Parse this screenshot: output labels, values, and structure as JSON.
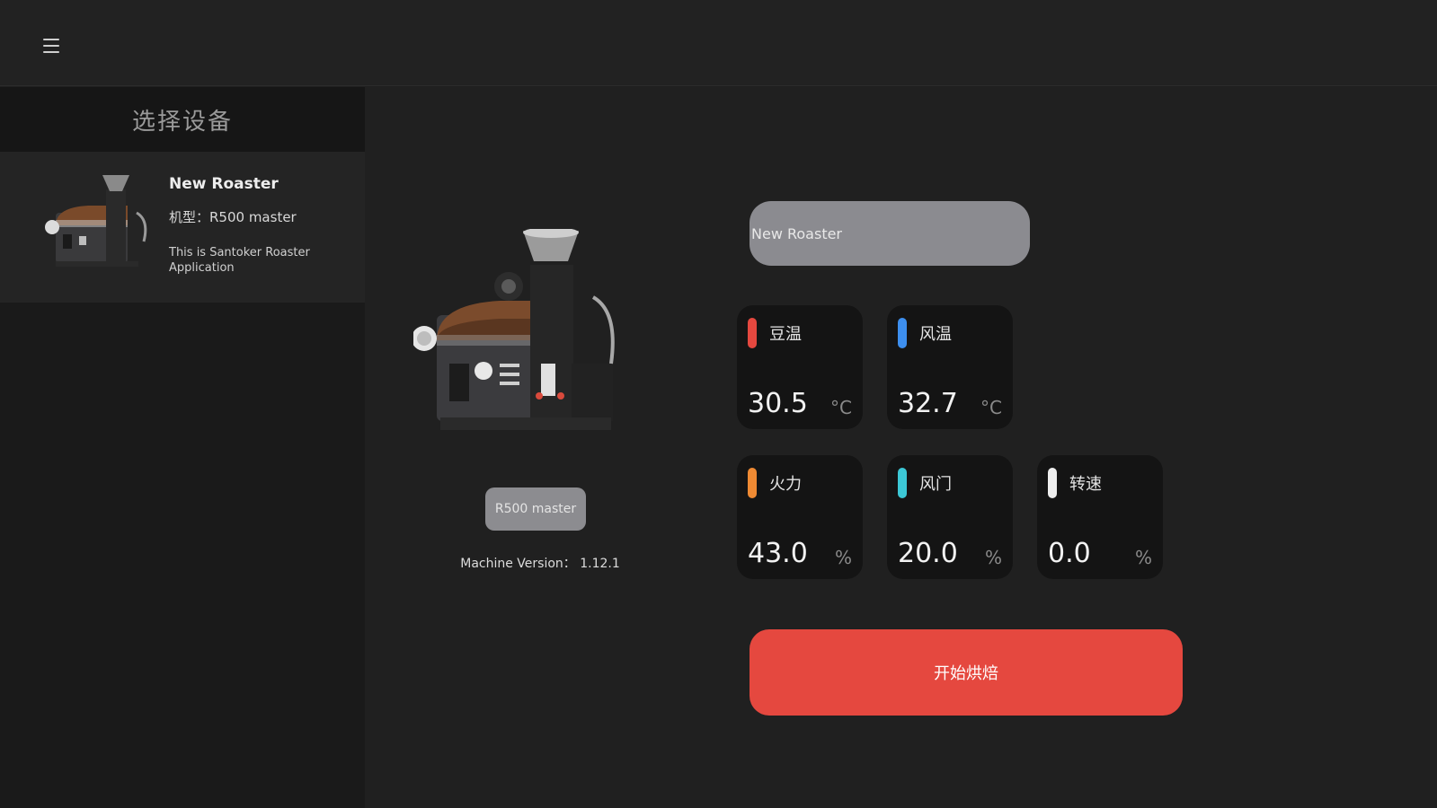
{
  "sidebar": {
    "title": "选择设备",
    "devices": [
      {
        "name": "New Roaster",
        "model": "机型：R500 master",
        "description": "This is Santoker Roaster Application"
      }
    ]
  },
  "main": {
    "model_badge": "R500 master",
    "version_label": "Machine Version：",
    "version_value": "1.12.1",
    "name_input": {
      "value": "New Roaster",
      "placeholder": "New Roaster"
    },
    "stats": [
      {
        "label": "豆温",
        "value": "30.5",
        "unit": "°C",
        "color": "#e5483f"
      },
      {
        "label": "风温",
        "value": "32.7",
        "unit": "°C",
        "color": "#3d8fef"
      },
      {
        "label": "火力",
        "value": "43.0",
        "unit": "%",
        "color": "#ef8a33"
      },
      {
        "label": "风门",
        "value": "20.0",
        "unit": "%",
        "color": "#3cc8d6"
      },
      {
        "label": "转速",
        "value": "0.0",
        "unit": "%",
        "color": "#eeeeee"
      }
    ],
    "start_button": "开始烘焙"
  },
  "icons": {
    "menu": "hamburger-menu-icon"
  }
}
